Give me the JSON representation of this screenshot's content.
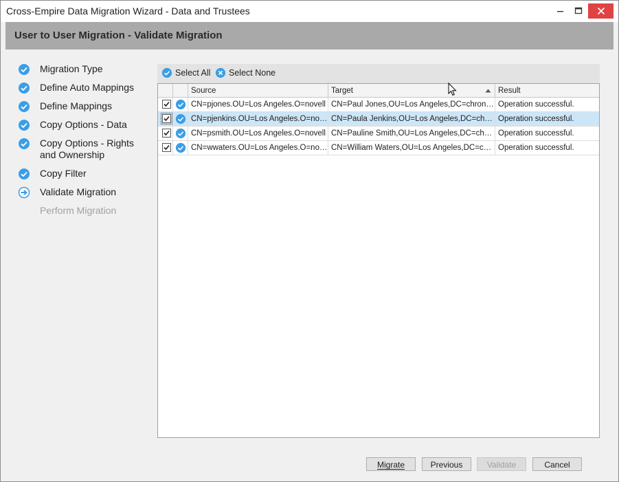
{
  "window": {
    "title": "Cross-Empire Data Migration Wizard  -  Data and Trustees",
    "controls": {
      "minimize": "minimize-icon",
      "maximize": "maximize-icon",
      "close": "close-icon"
    }
  },
  "header": {
    "title": "User to User Migration  -  Validate Migration"
  },
  "steps": [
    {
      "label": "Migration Type",
      "status": "done"
    },
    {
      "label": "Define Auto Mappings",
      "status": "done"
    },
    {
      "label": "Define Mappings",
      "status": "done"
    },
    {
      "label": "Copy Options - Data",
      "status": "done"
    },
    {
      "label": "Copy Options - Rights and Ownership",
      "status": "done"
    },
    {
      "label": "Copy Filter",
      "status": "done"
    },
    {
      "label": "Validate Migration",
      "status": "current"
    },
    {
      "label": "Perform Migration",
      "status": "pending"
    }
  ],
  "toolbar": {
    "select_all": "Select All",
    "select_none": "Select None"
  },
  "grid": {
    "columns": [
      "Source",
      "Target",
      "Result"
    ],
    "sorted_column": "Target",
    "rows": [
      {
        "checked": true,
        "source": "CN=pjones.OU=Los Angeles.O=novell",
        "target": "CN=Paul Jones,OU=Los Angeles,DC=chronicl...",
        "result": "Operation successful."
      },
      {
        "checked": true,
        "source": "CN=pjenkins.OU=Los Angeles.O=novell",
        "target": "CN=Paula Jenkins,OU=Los Angeles,DC=chron...",
        "result": "Operation successful.",
        "selected": true
      },
      {
        "checked": true,
        "source": "CN=psmith.OU=Los Angeles.O=novell",
        "target": "CN=Pauline Smith,OU=Los Angeles,DC=chron...",
        "result": "Operation successful."
      },
      {
        "checked": true,
        "source": "CN=wwaters.OU=Los Angeles.O=novell",
        "target": "CN=William Waters,OU=Los Angeles,DC=chro...",
        "result": "Operation successful."
      }
    ]
  },
  "buttons": {
    "migrate": "Migrate",
    "previous": "Previous",
    "validate": "Validate",
    "cancel": "Cancel"
  },
  "colors": {
    "accent": "#3a9ee6",
    "close": "#e04343",
    "header": "#a9a9a9",
    "selected_row": "#cde6f7"
  }
}
